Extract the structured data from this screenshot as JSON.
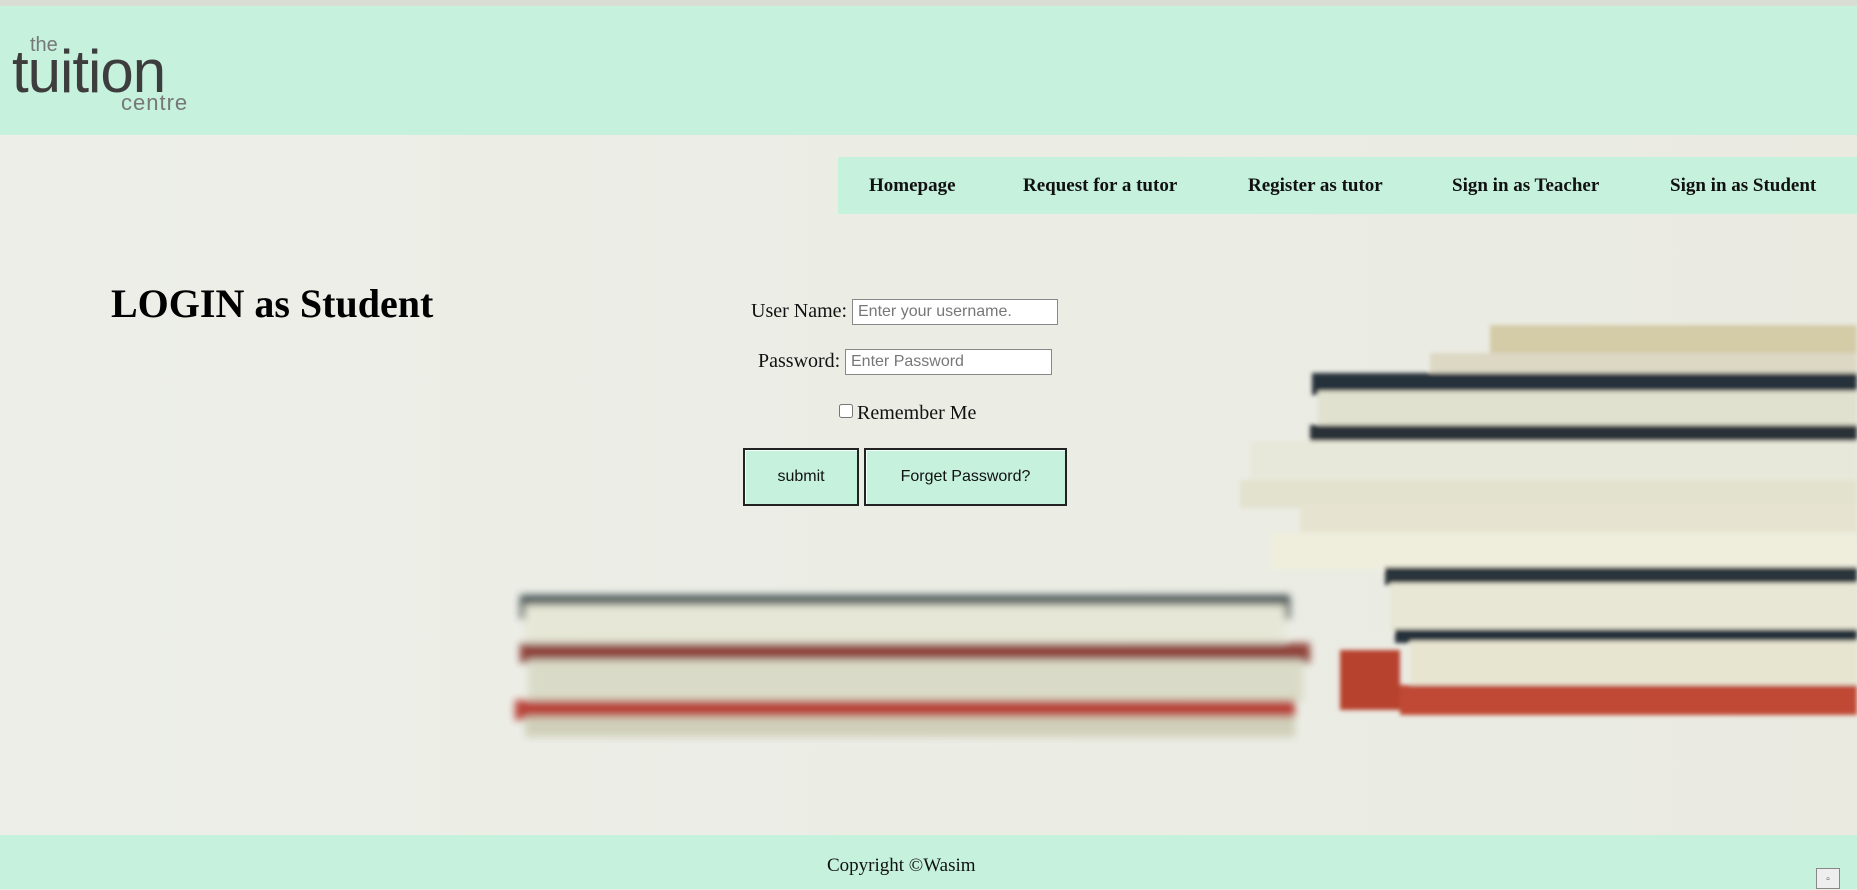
{
  "header": {
    "logo": {
      "line1": "the",
      "line2": "tuition",
      "line3": "centre"
    }
  },
  "nav": {
    "items": [
      {
        "label": "Homepage"
      },
      {
        "label": "Request for a tutor"
      },
      {
        "label": "Register as tutor"
      },
      {
        "label": "Sign in as Teacher"
      },
      {
        "label": "Sign in as Student"
      }
    ]
  },
  "login": {
    "title": "LOGIN as Student",
    "username_label": "User Name:",
    "username_placeholder": "Enter your username.",
    "password_label": "Password:",
    "password_placeholder": "Enter Password",
    "remember_label": "Remember Me",
    "submit_label": "submit",
    "forget_label": "Forget Password?"
  },
  "footer": {
    "copyright": "Copyright ©Wasim"
  },
  "colors": {
    "accent": "#c5f1dd",
    "text": "#111111"
  }
}
